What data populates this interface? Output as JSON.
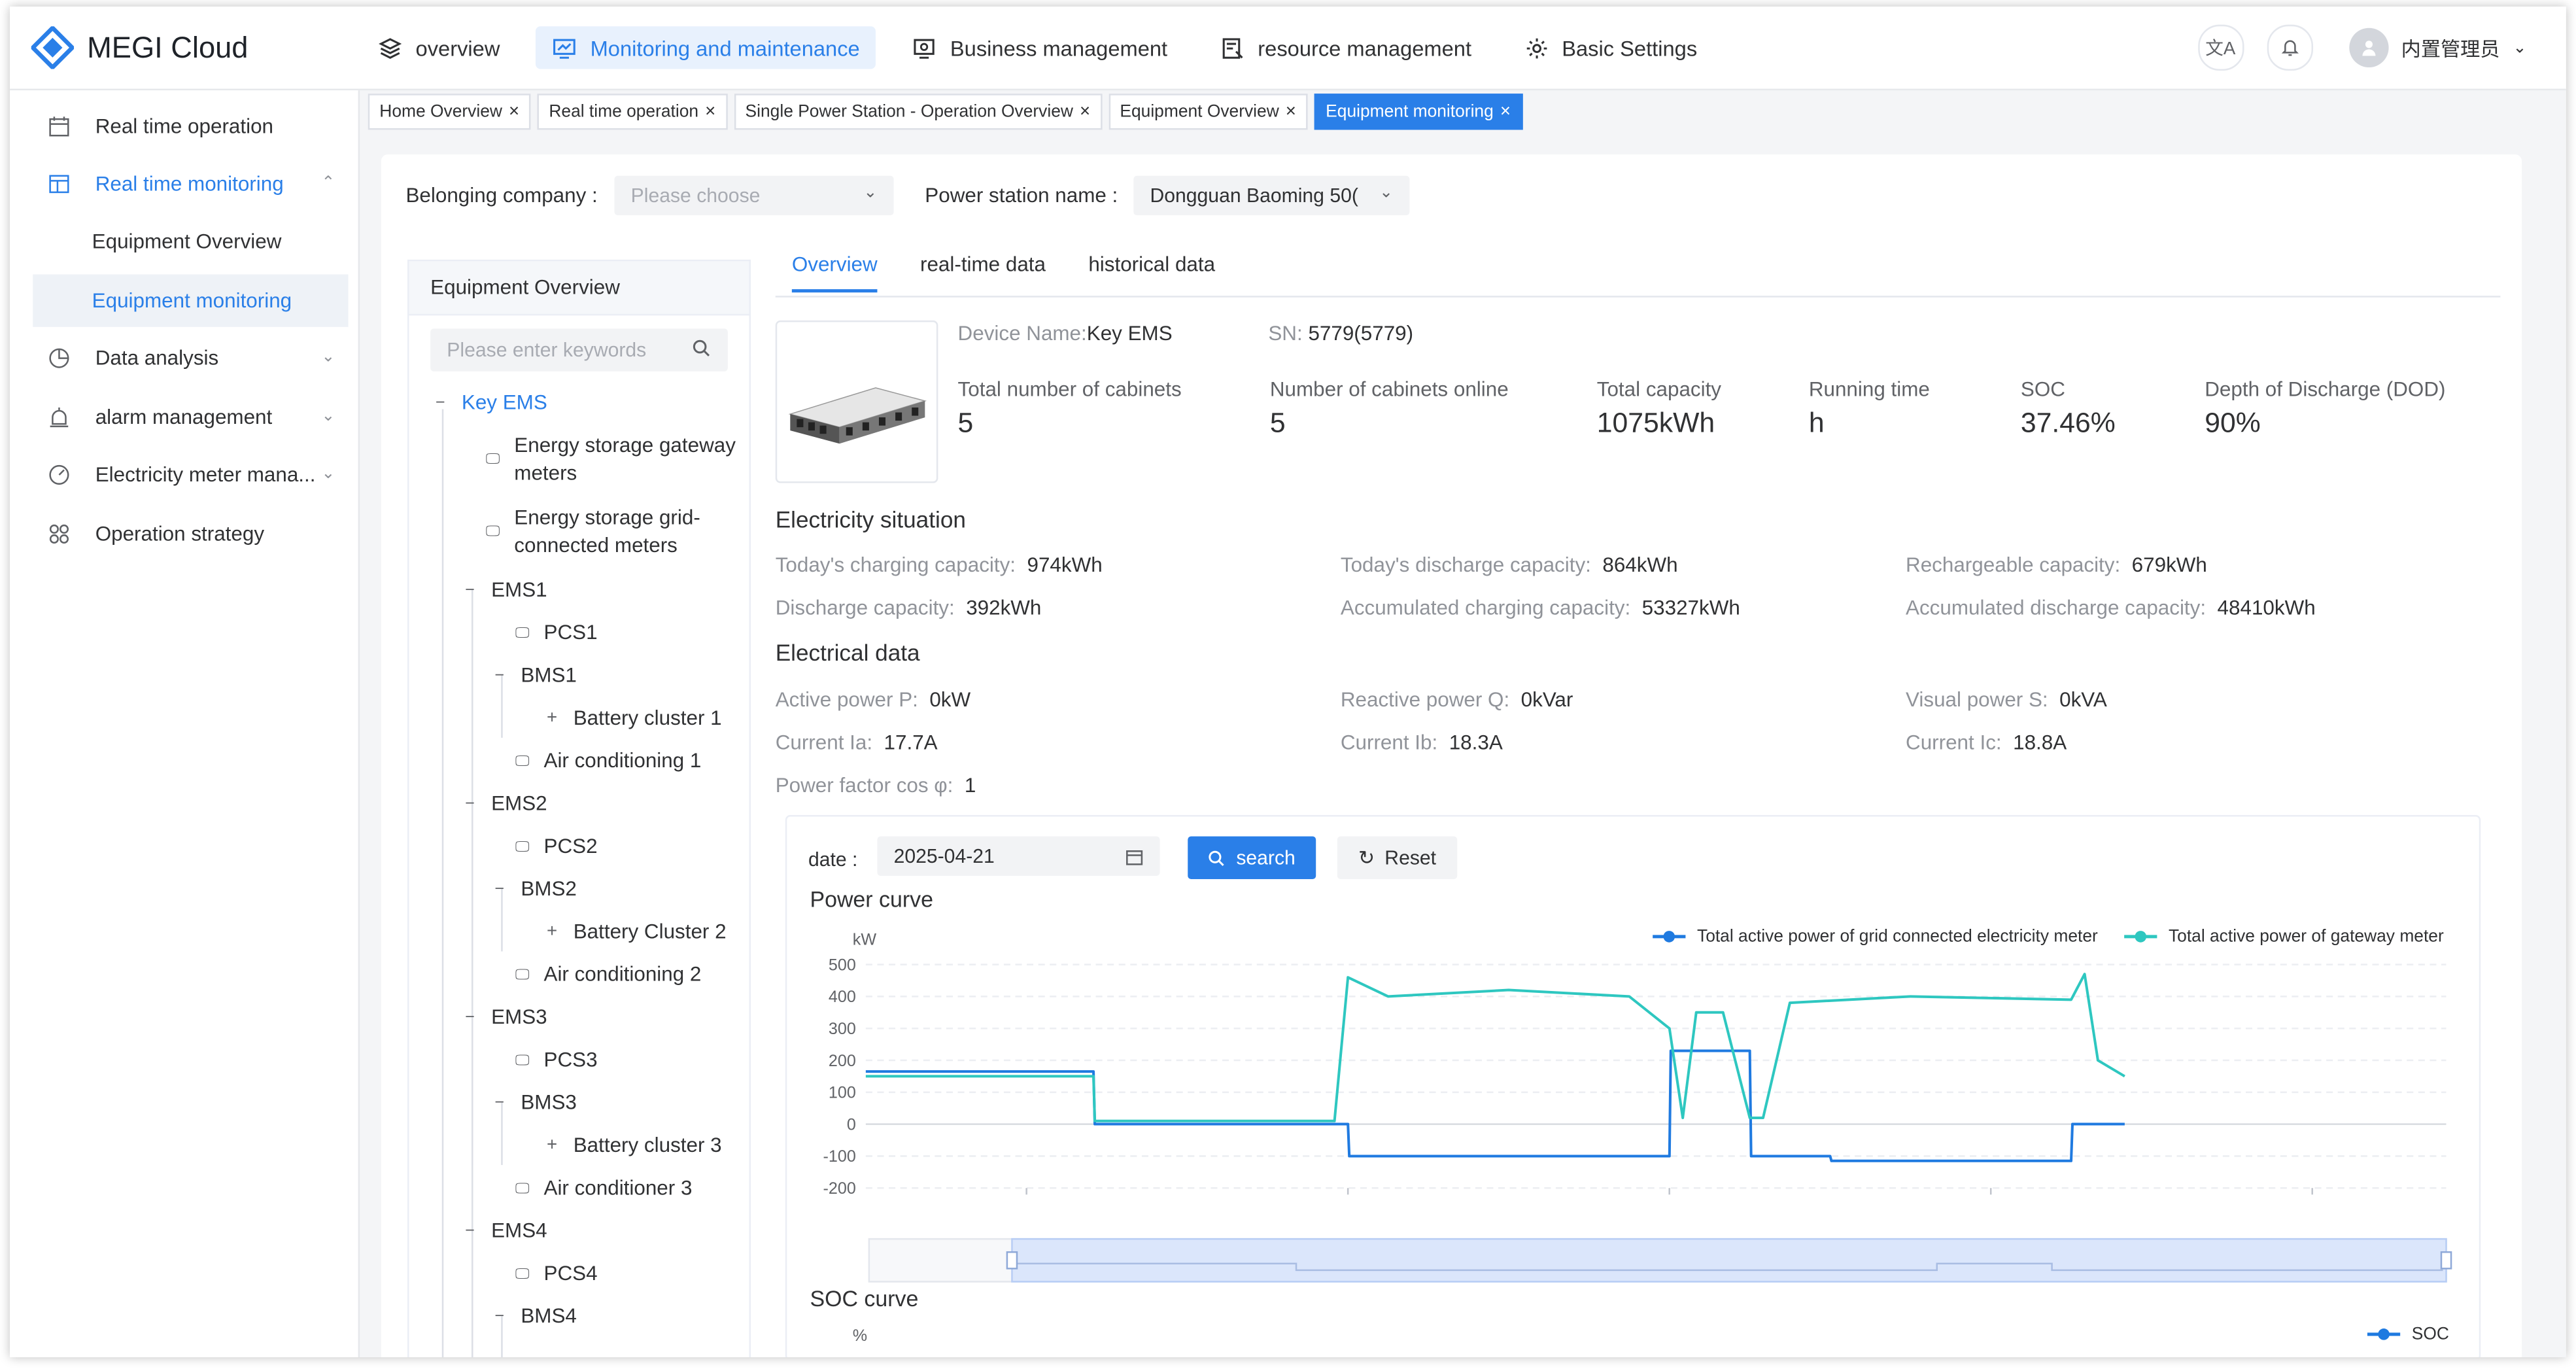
{
  "app": {
    "name": "MEGI Cloud"
  },
  "nav": [
    {
      "label": "overview",
      "icon": "layers-icon"
    },
    {
      "label": "Monitoring and maintenance",
      "icon": "monitor-icon"
    },
    {
      "label": "Business management",
      "icon": "business-icon"
    },
    {
      "label": "resource management",
      "icon": "resource-icon"
    },
    {
      "label": "Basic Settings",
      "icon": "gear-icon"
    }
  ],
  "user": {
    "name": "内置管理员"
  },
  "sidebar": {
    "items": [
      {
        "label": "Real time operation"
      },
      {
        "label": "Real time monitoring"
      },
      {
        "label": "Equipment Overview"
      },
      {
        "label": "Equipment monitoring"
      },
      {
        "label": "Data analysis"
      },
      {
        "label": "alarm management"
      },
      {
        "label": "Electricity meter mana..."
      },
      {
        "label": "Operation strategy"
      }
    ]
  },
  "tabs": [
    {
      "label": "Home Overview"
    },
    {
      "label": "Real time operation"
    },
    {
      "label": "Single Power Station - Operation Overview"
    },
    {
      "label": "Equipment Overview"
    },
    {
      "label": "Equipment monitoring"
    }
  ],
  "filters": {
    "company_label": "Belonging company :",
    "company_placeholder": "Please choose",
    "station_label": "Power station name :",
    "station_value": "Dongguan Baoming 50("
  },
  "tree": {
    "title": "Equipment Overview",
    "search_placeholder": "Please enter keywords",
    "nodes": [
      {
        "label": "Key EMS"
      },
      {
        "label": "Energy storage gateway meters"
      },
      {
        "label": "Energy storage grid-connected meters"
      },
      {
        "label": "EMS1"
      },
      {
        "label": "PCS1"
      },
      {
        "label": "BMS1"
      },
      {
        "label": "Battery cluster 1"
      },
      {
        "label": "Air conditioning 1"
      },
      {
        "label": "EMS2"
      },
      {
        "label": "PCS2"
      },
      {
        "label": "BMS2"
      },
      {
        "label": "Battery Cluster 2"
      },
      {
        "label": "Air conditioning 2"
      },
      {
        "label": "EMS3"
      },
      {
        "label": "PCS3"
      },
      {
        "label": "BMS3"
      },
      {
        "label": "Battery cluster 3"
      },
      {
        "label": "Air conditioner 3"
      },
      {
        "label": "EMS4"
      },
      {
        "label": "PCS4"
      },
      {
        "label": "BMS4"
      }
    ]
  },
  "detail": {
    "tabs": [
      "Overview",
      "real-time data",
      "historical data"
    ],
    "device_name_key": "Device Name:",
    "device_name": "Key EMS",
    "sn_key": "SN:",
    "sn": "5779(5779)",
    "stats": [
      {
        "label": "Total number of cabinets",
        "value": "5"
      },
      {
        "label": "Number of cabinets online",
        "value": "5"
      },
      {
        "label": "Total capacity",
        "value": "1075kWh"
      },
      {
        "label": "Running time",
        "value": "h"
      },
      {
        "label": "SOC",
        "value": "37.46%"
      },
      {
        "label": "Depth of Discharge (DOD)",
        "value": "90%"
      }
    ],
    "electricity_title": "Electricity situation",
    "electricity": [
      {
        "k": "Today's charging capacity:",
        "v": "974kWh"
      },
      {
        "k": "Today's discharge capacity:",
        "v": "864kWh"
      },
      {
        "k": "Rechargeable capacity:",
        "v": "679kWh"
      },
      {
        "k": "Discharge capacity:",
        "v": "392kWh"
      },
      {
        "k": "Accumulated charging capacity:",
        "v": "53327kWh"
      },
      {
        "k": "Accumulated discharge capacity:",
        "v": "48410kWh"
      }
    ],
    "electrical_title": "Electrical data",
    "electrical": [
      {
        "k": "Active power P:",
        "v": "0kW"
      },
      {
        "k": "Reactive power Q:",
        "v": "0kVar"
      },
      {
        "k": "Visual power S:",
        "v": "0kVA"
      },
      {
        "k": "Current Ia:",
        "v": "17.7A"
      },
      {
        "k": "Current Ib:",
        "v": "18.3A"
      },
      {
        "k": "Current Ic:",
        "v": "18.8A"
      },
      {
        "k": "Power factor cos φ:",
        "v": "1"
      }
    ]
  },
  "query": {
    "date_label": "date :",
    "date_value": "2025-04-21",
    "search_label": "search",
    "reset_label": "Reset"
  },
  "chart_data": {
    "type": "line",
    "title": "Power curve",
    "ylabel": "kW",
    "ylim": [
      -200,
      500
    ],
    "yticks": [
      "500",
      "400",
      "300",
      "200",
      "100",
      "0",
      "-100",
      "-200"
    ],
    "xticks": [
      "04:00",
      "08:00",
      "12:00",
      "16:00",
      "20:00"
    ],
    "legend_position": "top-right",
    "series": [
      {
        "name": "Total active power of grid connected electricity meter",
        "color": "#1f7ae0",
        "x": [
          "02:00",
          "04:50",
          "04:51",
          "08:00",
          "08:01",
          "12:00",
          "12:01",
          "13:00",
          "13:01",
          "14:00",
          "14:01",
          "17:00",
          "17:01",
          "17:40"
        ],
        "values": [
          165,
          165,
          0,
          0,
          -100,
          -100,
          230,
          230,
          -100,
          -100,
          -115,
          -115,
          0,
          0
        ]
      },
      {
        "name": "Total active power of gateway meter",
        "color": "#2ec7c0",
        "x": [
          "02:00",
          "04:50",
          "04:51",
          "07:50",
          "08:00",
          "08:30",
          "10:00",
          "11:30",
          "12:00",
          "12:10",
          "12:20",
          "12:40",
          "13:00",
          "13:10",
          "13:30",
          "15:00",
          "17:00",
          "17:10",
          "17:20",
          "17:40"
        ],
        "values": [
          150,
          150,
          10,
          10,
          460,
          400,
          420,
          400,
          300,
          20,
          350,
          350,
          20,
          20,
          380,
          400,
          390,
          470,
          200,
          150
        ]
      }
    ]
  },
  "soc_chart": {
    "title": "SOC curve",
    "ylabel": "%",
    "legend": "SOC"
  }
}
